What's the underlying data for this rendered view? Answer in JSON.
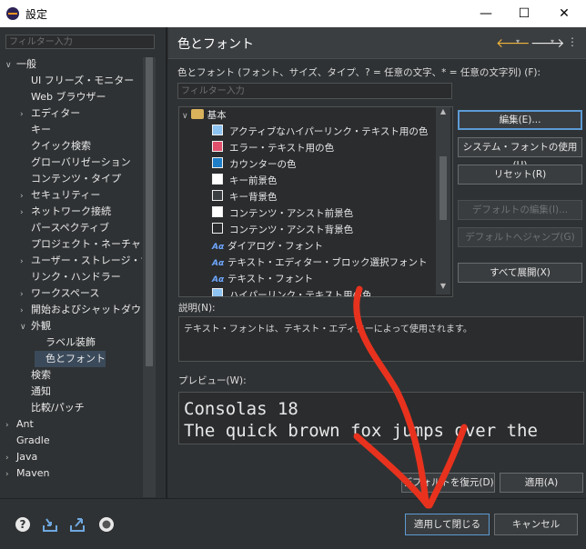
{
  "window": {
    "title": "設定",
    "minimize": "—",
    "maximize": "☐",
    "close": "✕"
  },
  "left": {
    "filter_placeholder": "フィルター入力",
    "tree": [
      {
        "label": "一般",
        "twisty": "∨",
        "level": 0
      },
      {
        "label": "UI フリーズ・モニター",
        "twisty": "",
        "level": 1
      },
      {
        "label": "Web ブラウザー",
        "twisty": "",
        "level": 1
      },
      {
        "label": "エディター",
        "twisty": "›",
        "level": 1
      },
      {
        "label": "キー",
        "twisty": "",
        "level": 1
      },
      {
        "label": "クイック検索",
        "twisty": "",
        "level": 1
      },
      {
        "label": "グローバリゼーション",
        "twisty": "",
        "level": 1
      },
      {
        "label": "コンテンツ・タイプ",
        "twisty": "",
        "level": 1
      },
      {
        "label": "セキュリティー",
        "twisty": "›",
        "level": 1
      },
      {
        "label": "ネットワーク接続",
        "twisty": "›",
        "level": 1
      },
      {
        "label": "パースペクティブ",
        "twisty": "",
        "level": 1
      },
      {
        "label": "プロジェクト・ネーチャー",
        "twisty": "",
        "level": 1
      },
      {
        "label": "ユーザー・ストレージ・サー",
        "twisty": "›",
        "level": 1
      },
      {
        "label": "リンク・ハンドラー",
        "twisty": "",
        "level": 1
      },
      {
        "label": "ワークスペース",
        "twisty": "›",
        "level": 1
      },
      {
        "label": "開始およびシャットダウン",
        "twisty": "›",
        "level": 1
      },
      {
        "label": "外観",
        "twisty": "∨",
        "level": 1
      },
      {
        "label": "ラベル装飾",
        "twisty": "",
        "level": 2
      },
      {
        "label": "色とフォント",
        "twisty": "",
        "level": 2
      },
      {
        "label": "検索",
        "twisty": "",
        "level": 1
      },
      {
        "label": "通知",
        "twisty": "",
        "level": 1
      },
      {
        "label": "比較/パッチ",
        "twisty": "",
        "level": 1
      },
      {
        "label": "Ant",
        "twisty": "›",
        "level": 0
      },
      {
        "label": "Gradle",
        "twisty": "",
        "level": 0
      },
      {
        "label": "Java",
        "twisty": "›",
        "level": 0
      },
      {
        "label": "Maven",
        "twisty": "›",
        "level": 0
      }
    ]
  },
  "right": {
    "page_title": "色とフォント",
    "description": "色とフォント (フォント、サイズ、タイプ、? = 任意の文字、* = 任意の文字列) (F):",
    "filter_placeholder": "フィルター入力",
    "root": "基本",
    "items": [
      {
        "label": "アクティブなハイパーリンク・テキスト用の色",
        "kind": "color",
        "color": "#8ec4f2"
      },
      {
        "label": "エラー・テキスト用の色",
        "kind": "color",
        "color": "#e0506a"
      },
      {
        "label": "カウンターの色",
        "kind": "color",
        "color": "#1e7ec8"
      },
      {
        "label": "キー前景色",
        "kind": "color",
        "color": "#ffffff"
      },
      {
        "label": "キー背景色",
        "kind": "color",
        "color": "#3c3f41"
      },
      {
        "label": "コンテンツ・アシスト前景色",
        "kind": "color",
        "color": "#ffffff"
      },
      {
        "label": "コンテンツ・アシスト背景色",
        "kind": "color",
        "color": "#2a2c2e"
      },
      {
        "label": "ダイアログ・フォント",
        "kind": "font",
        "color": ""
      },
      {
        "label": "テキスト・エディター・ブロック選択フォント",
        "kind": "font",
        "color": ""
      },
      {
        "label": "テキスト・フォント",
        "kind": "font",
        "color": ""
      },
      {
        "label": "ハイパーリンク・テキスト用の色",
        "kind": "color",
        "color": "#8ec4f2"
      }
    ],
    "font_icon_text": "Aα",
    "buttons": {
      "edit": "編集(E)...",
      "use_system_font": "システム・フォントの使用(U)",
      "reset": "リセット(R)",
      "edit_default": "デフォルトの編集(I)...",
      "go_default": "デフォルトへジャンプ(G)",
      "expand_all": "すべて展開(X)"
    },
    "explanation_label": "説明(N):",
    "explanation_text": "テキスト・フォントは、テキスト・エディターによって使用されます。",
    "preview_label": "プレビュー(W):",
    "preview_line1": "Consolas 18",
    "preview_line2": "The quick brown fox jumps over the",
    "restore_defaults": "デフォルトを復元(D)",
    "apply": "適用(A)"
  },
  "bottom": {
    "apply_close": "適用して閉じる",
    "cancel": "キャンセル"
  }
}
